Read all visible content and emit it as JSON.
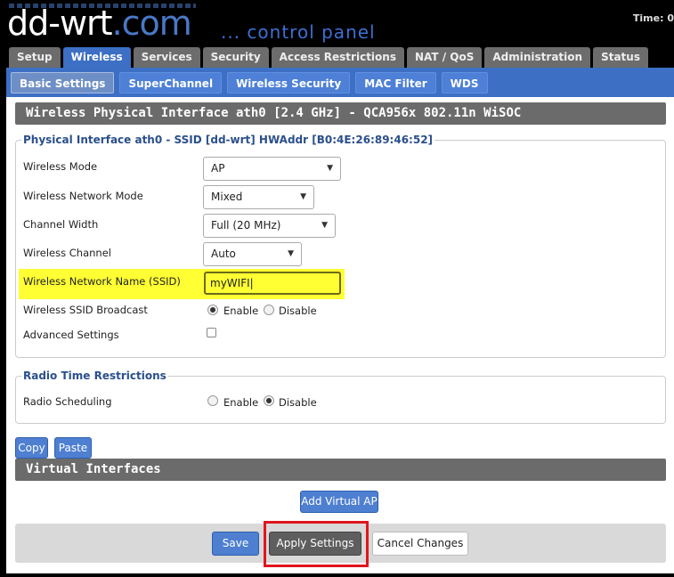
{
  "header": {
    "logo_main": "dd-wrt",
    "logo_suffix": ".com",
    "tagline": "... control panel",
    "time_label": "Time: 0"
  },
  "main_tabs": [
    {
      "label": "Setup",
      "active": false
    },
    {
      "label": "Wireless",
      "active": true
    },
    {
      "label": "Services",
      "active": false
    },
    {
      "label": "Security",
      "active": false
    },
    {
      "label": "Access Restrictions",
      "active": false
    },
    {
      "label": "NAT / QoS",
      "active": false
    },
    {
      "label": "Administration",
      "active": false
    },
    {
      "label": "Status",
      "active": false
    }
  ],
  "sub_tabs": [
    {
      "label": "Basic Settings",
      "active": true
    },
    {
      "label": "SuperChannel",
      "active": false
    },
    {
      "label": "Wireless Security",
      "active": false
    },
    {
      "label": "MAC Filter",
      "active": false
    },
    {
      "label": "WDS",
      "active": false
    }
  ],
  "section_title": "Wireless Physical Interface ath0 [2.4 GHz] - QCA956x 802.11n WiSOC",
  "physical": {
    "legend": "Physical Interface ath0 - SSID [dd-wrt] HWAddr [B0:4E:26:89:46:52]",
    "wireless_mode": {
      "label": "Wireless Mode",
      "value": "AP"
    },
    "network_mode": {
      "label": "Wireless Network Mode",
      "value": "Mixed"
    },
    "channel_width": {
      "label": "Channel Width",
      "value": "Full (20 MHz)"
    },
    "channel": {
      "label": "Wireless Channel",
      "value": "Auto"
    },
    "ssid": {
      "label": "Wireless Network Name (SSID)",
      "value": "myWIFI"
    },
    "ssid_broadcast": {
      "label": "Wireless SSID Broadcast",
      "enable": "Enable",
      "disable": "Disable",
      "selected": "Enable"
    },
    "advanced": {
      "label": "Advanced Settings",
      "checked": false
    }
  },
  "radio_time": {
    "legend": "Radio Time Restrictions",
    "label": "Radio Scheduling",
    "enable": "Enable",
    "disable": "Disable",
    "selected": "Disable"
  },
  "copy_label": "Copy",
  "paste_label": "Paste",
  "virtual_title": "Virtual Interfaces",
  "add_vap_label": "Add Virtual AP",
  "save_label": "Save",
  "apply_label": "Apply Settings",
  "cancel_label": "Cancel Changes",
  "colors": {
    "accent": "#3d6fc4",
    "highlight": "#ffff33",
    "outline": "#e0161d"
  }
}
